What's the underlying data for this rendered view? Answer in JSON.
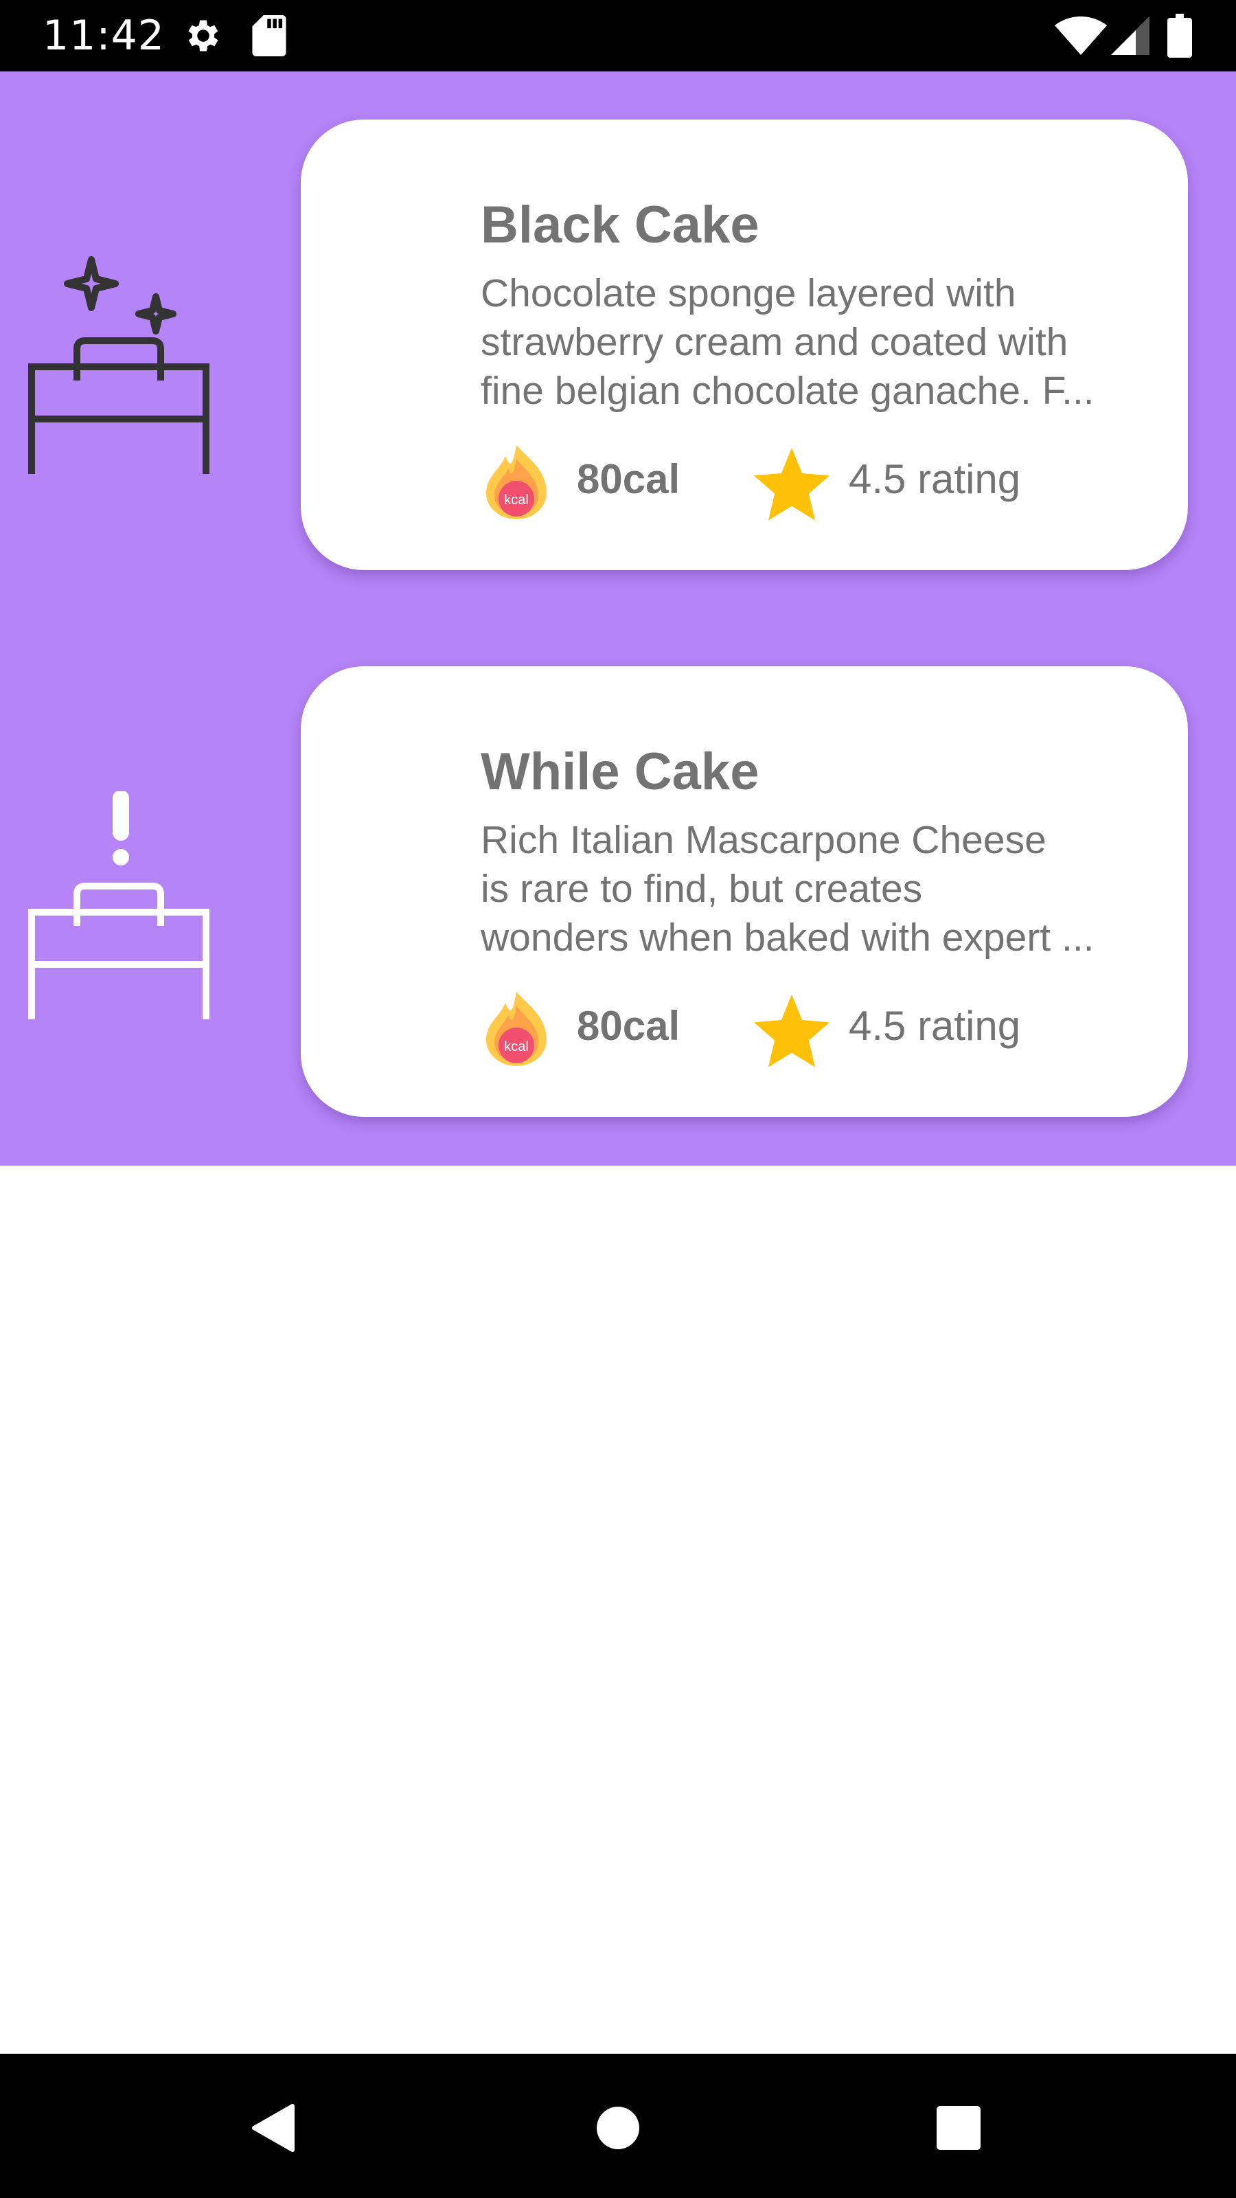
{
  "status_bar": {
    "time": "11:42",
    "icons": [
      "settings-gear-icon",
      "sd-card-icon",
      "wifi-icon",
      "signal-icon",
      "battery-icon"
    ]
  },
  "colors": {
    "background_accent": "#b584f7",
    "card_background": "#ffffff",
    "text_muted": "#737373",
    "star": "#ffc107",
    "status_bar": "#000000",
    "nav_bar": "#000000"
  },
  "items": [
    {
      "icon": "clean-bed-sparkles-icon",
      "title": "Black Cake",
      "description_lines": [
        "Chocolate sponge layered with",
        "strawberry cream and coated with",
        "fine belgian chocolate ganache. F..."
      ],
      "calories_icon": "kcal-flame-icon",
      "calories": "80cal",
      "rating_icon": "star-icon",
      "rating": "4.5 rating"
    },
    {
      "icon": "bed-alert-icon",
      "title": "While Cake",
      "description_lines": [
        "Rich Italian Mascarpone Cheese",
        "is rare to find, but creates",
        "wonders when baked with expert ..."
      ],
      "calories_icon": "kcal-flame-icon",
      "calories": "80cal",
      "rating_icon": "star-icon",
      "rating": "4.5 rating"
    }
  ],
  "nav_bar": {
    "buttons": [
      "back-icon",
      "home-icon",
      "recents-icon"
    ]
  }
}
